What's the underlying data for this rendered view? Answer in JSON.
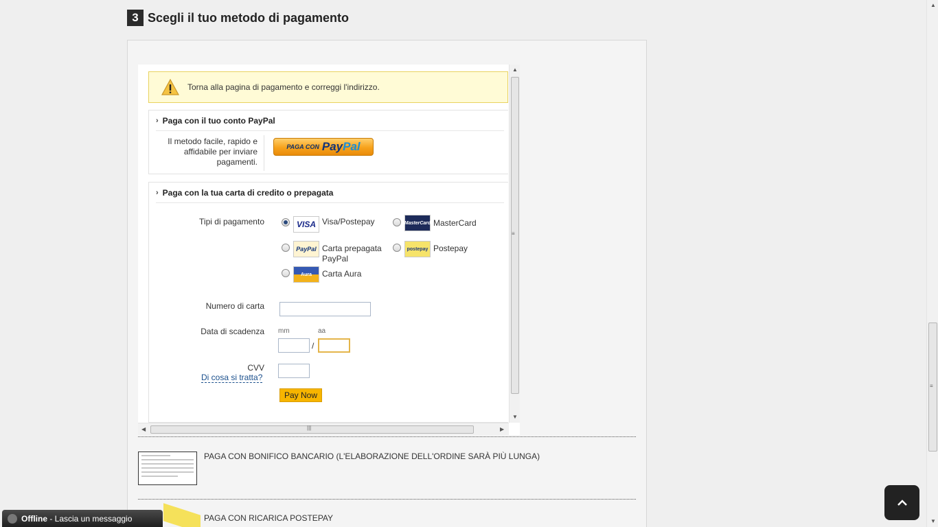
{
  "step": {
    "number": "3",
    "title": "Scegli il tuo metodo di pagamento"
  },
  "warning": {
    "text": "Torna alla pagina di pagamento e correggi l'indirizzo."
  },
  "paypal": {
    "heading": "Paga con il tuo conto PayPal",
    "description_lines": [
      "Il metodo facile, rapido e",
      "affidabile per inviare",
      "pagamenti."
    ],
    "button_prefix": "PAGA CON",
    "button_brand_a": "Pay",
    "button_brand_b": "Pal"
  },
  "card": {
    "heading": "Paga con la tua carta di credito o prepagata",
    "payment_types_label": "Tipi di pagamento",
    "options": [
      {
        "name_line1": "Visa/Postepay",
        "name_line2": "",
        "logo": "VISA",
        "icon": "visa-icon",
        "selected": true
      },
      {
        "name_line1": "MasterCard",
        "name_line2": "",
        "logo": "MasterCard",
        "icon": "mastercard-icon",
        "selected": false
      },
      {
        "name_line1": "Carta prepagata",
        "name_line2": "PayPal",
        "logo": "PayPal",
        "icon": "paypal-prepaid-icon",
        "selected": false
      },
      {
        "name_line1": "Postepay",
        "name_line2": "",
        "logo": "postepay",
        "icon": "postepay-icon",
        "selected": false
      },
      {
        "name_line1": "Carta Aura",
        "name_line2": "",
        "logo": "Aura",
        "icon": "aura-icon",
        "selected": false
      }
    ],
    "card_number_label": "Numero di carta",
    "card_number_value": "",
    "expiry_label": "Data di scadenza",
    "month_hint": "mm",
    "year_hint": "aa",
    "separator": "/",
    "month_value": "",
    "year_value": "",
    "cvv_label": "CVV",
    "cvv_help": "Di cosa si tratta?",
    "cvv_value": "",
    "pay_button": "Pay Now"
  },
  "other_methods": [
    {
      "label": "PAGA CON BONIFICO BANCARIO (L'ELABORAZIONE DELL'ORDINE SARÀ PIÙ LUNGA)",
      "icon": "bank-transfer-form-icon"
    },
    {
      "label": "PAGA CON RICARICA POSTEPAY",
      "icon": "postepay-card-icon"
    }
  ],
  "chat": {
    "status": "Offline",
    "message": " - Lascia un messaggio"
  },
  "colors": {
    "accent": "#f7b500",
    "warning_bg": "#fffbd6",
    "link": "#1a4f8c"
  }
}
